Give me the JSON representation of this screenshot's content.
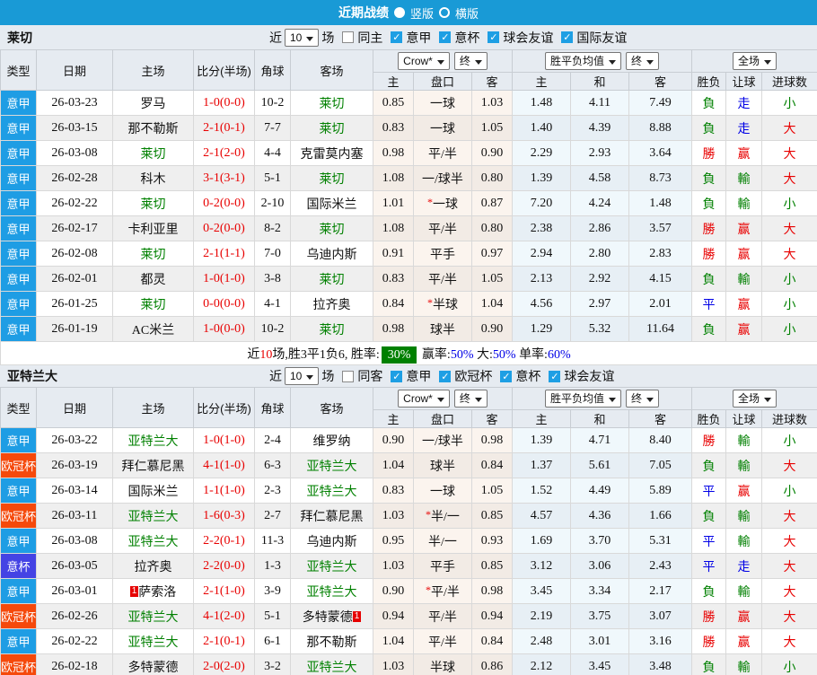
{
  "top_bar": {
    "title": "近期战绩",
    "modes": [
      {
        "label": "竖版",
        "selected": true
      },
      {
        "label": "横版",
        "selected": false
      }
    ]
  },
  "colors": {
    "bar_blue": "#199AD6",
    "league_意甲": "#1E9DE4",
    "league_欧冠杯": "#F5490B",
    "league_意杯": "#4443E4",
    "win_red": "#E80000",
    "lose_green": "#008000",
    "draw_blue": "#0000E6",
    "team_green": "#008000",
    "badge_green": "#008000"
  },
  "result_colors": {
    "勝": "redtx",
    "負": "green",
    "平": "blutx",
    "赢": "redtx",
    "輸": "green",
    "走": "blutx",
    "大": "redtx",
    "小": "green"
  },
  "header": {
    "cols": [
      "类型",
      "日期",
      "主场",
      "比分(半场)",
      "角球",
      "客场"
    ],
    "odds_selects": [
      "Crow*",
      "终"
    ],
    "avg_selects": [
      "胜平负均值",
      "终"
    ],
    "result_selects": [
      "全场"
    ],
    "sub": [
      "主",
      "盘口",
      "客",
      "主",
      "和",
      "客",
      "胜负",
      "让球",
      "进球数"
    ]
  },
  "sections": [
    {
      "team": "莱切",
      "filters": {
        "prefix": "近",
        "count": "10",
        "suffix": "场",
        "same": {
          "label": "同主",
          "checked": false
        },
        "leagues": [
          {
            "label": "意甲",
            "checked": true
          },
          {
            "label": "意杯",
            "checked": true
          },
          {
            "label": "球会友谊",
            "checked": true
          },
          {
            "label": "国际友谊",
            "checked": true
          }
        ]
      },
      "rows": [
        {
          "league": "意甲",
          "date": "26-03-23",
          "home": {
            "name": "罗马"
          },
          "score": "1-0(0-0)",
          "corner": "10-2",
          "away": {
            "name": "莱切",
            "green": true
          },
          "o": [
            "0.85",
            "一球",
            "1.03"
          ],
          "star": false,
          "avg": [
            "1.48",
            "4.11",
            "7.49"
          ],
          "res": [
            "負",
            "走",
            "小"
          ]
        },
        {
          "league": "意甲",
          "date": "26-03-15",
          "home": {
            "name": "那不勒斯"
          },
          "score": "2-1(0-1)",
          "corner": "7-7",
          "away": {
            "name": "莱切",
            "green": true
          },
          "o": [
            "0.83",
            "一球",
            "1.05"
          ],
          "star": false,
          "avg": [
            "1.40",
            "4.39",
            "8.88"
          ],
          "res": [
            "負",
            "走",
            "大"
          ]
        },
        {
          "league": "意甲",
          "date": "26-03-08",
          "home": {
            "name": "莱切",
            "green": true
          },
          "score": "2-1(2-0)",
          "corner": "4-4",
          "away": {
            "name": "克雷莫内塞"
          },
          "o": [
            "0.98",
            "平/半",
            "0.90"
          ],
          "star": false,
          "avg": [
            "2.29",
            "2.93",
            "3.64"
          ],
          "res": [
            "勝",
            "赢",
            "大"
          ]
        },
        {
          "league": "意甲",
          "date": "26-02-28",
          "home": {
            "name": "科木"
          },
          "score": "3-1(3-1)",
          "corner": "5-1",
          "away": {
            "name": "莱切",
            "green": true
          },
          "o": [
            "1.08",
            "一/球半",
            "0.80"
          ],
          "star": false,
          "avg": [
            "1.39",
            "4.58",
            "8.73"
          ],
          "res": [
            "負",
            "輸",
            "大"
          ]
        },
        {
          "league": "意甲",
          "date": "26-02-22",
          "home": {
            "name": "莱切",
            "green": true
          },
          "score": "0-2(0-0)",
          "corner": "2-10",
          "away": {
            "name": "国际米兰"
          },
          "o": [
            "1.01",
            "一球",
            "0.87"
          ],
          "star": true,
          "avg": [
            "7.20",
            "4.24",
            "1.48"
          ],
          "res": [
            "負",
            "輸",
            "小"
          ]
        },
        {
          "league": "意甲",
          "date": "26-02-17",
          "home": {
            "name": "卡利亚里"
          },
          "score": "0-2(0-0)",
          "corner": "8-2",
          "away": {
            "name": "莱切",
            "green": true
          },
          "o": [
            "1.08",
            "平/半",
            "0.80"
          ],
          "star": false,
          "avg": [
            "2.38",
            "2.86",
            "3.57"
          ],
          "res": [
            "勝",
            "赢",
            "大"
          ]
        },
        {
          "league": "意甲",
          "date": "26-02-08",
          "home": {
            "name": "莱切",
            "green": true
          },
          "score": "2-1(1-1)",
          "corner": "7-0",
          "away": {
            "name": "乌迪内斯"
          },
          "o": [
            "0.91",
            "平手",
            "0.97"
          ],
          "star": false,
          "avg": [
            "2.94",
            "2.80",
            "2.83"
          ],
          "res": [
            "勝",
            "赢",
            "大"
          ]
        },
        {
          "league": "意甲",
          "date": "26-02-01",
          "home": {
            "name": "都灵"
          },
          "score": "1-0(1-0)",
          "corner": "3-8",
          "away": {
            "name": "莱切",
            "green": true
          },
          "o": [
            "0.83",
            "平/半",
            "1.05"
          ],
          "star": false,
          "avg": [
            "2.13",
            "2.92",
            "4.15"
          ],
          "res": [
            "負",
            "輸",
            "小"
          ]
        },
        {
          "league": "意甲",
          "date": "26-01-25",
          "home": {
            "name": "莱切",
            "green": true
          },
          "score": "0-0(0-0)",
          "corner": "4-1",
          "away": {
            "name": "拉齐奥"
          },
          "o": [
            "0.84",
            "半球",
            "1.04"
          ],
          "star": true,
          "avg": [
            "4.56",
            "2.97",
            "2.01"
          ],
          "res": [
            "平",
            "赢",
            "小"
          ]
        },
        {
          "league": "意甲",
          "date": "26-01-19",
          "home": {
            "name": "AC米兰"
          },
          "score": "1-0(0-0)",
          "corner": "10-2",
          "away": {
            "name": "莱切",
            "green": true
          },
          "o": [
            "0.98",
            "球半",
            "0.90"
          ],
          "star": false,
          "avg": [
            "1.29",
            "5.32",
            "11.64"
          ],
          "res": [
            "負",
            "赢",
            "小"
          ]
        }
      ],
      "summary": [
        {
          "t": "近"
        },
        {
          "t": "10",
          "c": "redtx"
        },
        {
          "t": "场,胜3平1负6, 胜率:"
        },
        {
          "t": "30%",
          "c": "badge"
        },
        {
          "t": " 赢率:"
        },
        {
          "t": "50%",
          "c": "blutx"
        },
        {
          "t": " 大:"
        },
        {
          "t": "50%",
          "c": "blutx"
        },
        {
          "t": " 单率:"
        },
        {
          "t": "60%",
          "c": "blutx"
        }
      ]
    },
    {
      "team": "亚特兰大",
      "filters": {
        "prefix": "近",
        "count": "10",
        "suffix": "场",
        "same": {
          "label": "同客",
          "checked": false
        },
        "leagues": [
          {
            "label": "意甲",
            "checked": true
          },
          {
            "label": "欧冠杯",
            "checked": true
          },
          {
            "label": "意杯",
            "checked": true
          },
          {
            "label": "球会友谊",
            "checked": true
          }
        ]
      },
      "rows": [
        {
          "league": "意甲",
          "date": "26-03-22",
          "home": {
            "name": "亚特兰大",
            "green": true
          },
          "score": "1-0(1-0)",
          "corner": "2-4",
          "away": {
            "name": "维罗纳"
          },
          "o": [
            "0.90",
            "一/球半",
            "0.98"
          ],
          "star": false,
          "avg": [
            "1.39",
            "4.71",
            "8.40"
          ],
          "res": [
            "勝",
            "輸",
            "小"
          ]
        },
        {
          "league": "欧冠杯",
          "date": "26-03-19",
          "home": {
            "name": "拜仁慕尼黑"
          },
          "score": "4-1(1-0)",
          "corner": "6-3",
          "away": {
            "name": "亚特兰大",
            "green": true
          },
          "o": [
            "1.04",
            "球半",
            "0.84"
          ],
          "star": false,
          "avg": [
            "1.37",
            "5.61",
            "7.05"
          ],
          "res": [
            "負",
            "輸",
            "大"
          ]
        },
        {
          "league": "意甲",
          "date": "26-03-14",
          "home": {
            "name": "国际米兰"
          },
          "score": "1-1(1-0)",
          "corner": "2-3",
          "away": {
            "name": "亚特兰大",
            "green": true
          },
          "o": [
            "0.83",
            "一球",
            "1.05"
          ],
          "star": false,
          "avg": [
            "1.52",
            "4.49",
            "5.89"
          ],
          "res": [
            "平",
            "赢",
            "小"
          ]
        },
        {
          "league": "欧冠杯",
          "date": "26-03-11",
          "home": {
            "name": "亚特兰大",
            "green": true
          },
          "score": "1-6(0-3)",
          "corner": "2-7",
          "away": {
            "name": "拜仁慕尼黑"
          },
          "o": [
            "1.03",
            "半/一",
            "0.85"
          ],
          "star": true,
          "avg": [
            "4.57",
            "4.36",
            "1.66"
          ],
          "res": [
            "負",
            "輸",
            "大"
          ]
        },
        {
          "league": "意甲",
          "date": "26-03-08",
          "home": {
            "name": "亚特兰大",
            "green": true
          },
          "score": "2-2(0-1)",
          "corner": "11-3",
          "away": {
            "name": "乌迪内斯"
          },
          "o": [
            "0.95",
            "半/一",
            "0.93"
          ],
          "star": false,
          "avg": [
            "1.69",
            "3.70",
            "5.31"
          ],
          "res": [
            "平",
            "輸",
            "大"
          ]
        },
        {
          "league": "意杯",
          "date": "26-03-05",
          "home": {
            "name": "拉齐奥"
          },
          "score": "2-2(0-0)",
          "corner": "1-3",
          "away": {
            "name": "亚特兰大",
            "green": true
          },
          "o": [
            "1.03",
            "平手",
            "0.85"
          ],
          "star": false,
          "avg": [
            "3.12",
            "3.06",
            "2.43"
          ],
          "res": [
            "平",
            "走",
            "大"
          ]
        },
        {
          "league": "意甲",
          "date": "26-03-01",
          "home": {
            "name": "萨索洛",
            "card": "1",
            "card_pos": "pre"
          },
          "score": "2-1(1-0)",
          "corner": "3-9",
          "away": {
            "name": "亚特兰大",
            "green": true
          },
          "o": [
            "0.90",
            "平/半",
            "0.98"
          ],
          "star": true,
          "avg": [
            "3.45",
            "3.34",
            "2.17"
          ],
          "res": [
            "負",
            "輸",
            "大"
          ]
        },
        {
          "league": "欧冠杯",
          "date": "26-02-26",
          "home": {
            "name": "亚特兰大",
            "green": true
          },
          "score": "4-1(2-0)",
          "corner": "5-1",
          "away": {
            "name": "多特蒙德",
            "card": "1",
            "card_pos": "post"
          },
          "o": [
            "0.94",
            "平/半",
            "0.94"
          ],
          "star": false,
          "avg": [
            "2.19",
            "3.75",
            "3.07"
          ],
          "res": [
            "勝",
            "赢",
            "大"
          ]
        },
        {
          "league": "意甲",
          "date": "26-02-22",
          "home": {
            "name": "亚特兰大",
            "green": true
          },
          "score": "2-1(0-1)",
          "corner": "6-1",
          "away": {
            "name": "那不勒斯"
          },
          "o": [
            "1.04",
            "平/半",
            "0.84"
          ],
          "star": false,
          "avg": [
            "2.48",
            "3.01",
            "3.16"
          ],
          "res": [
            "勝",
            "赢",
            "大"
          ]
        },
        {
          "league": "欧冠杯",
          "date": "26-02-18",
          "home": {
            "name": "多特蒙德"
          },
          "score": "2-0(2-0)",
          "corner": "3-2",
          "away": {
            "name": "亚特兰大",
            "green": true
          },
          "o": [
            "1.03",
            "半球",
            "0.86"
          ],
          "star": false,
          "avg": [
            "2.12",
            "3.45",
            "3.48"
          ],
          "res": [
            "負",
            "輸",
            "小"
          ]
        }
      ],
      "summary": null
    }
  ]
}
